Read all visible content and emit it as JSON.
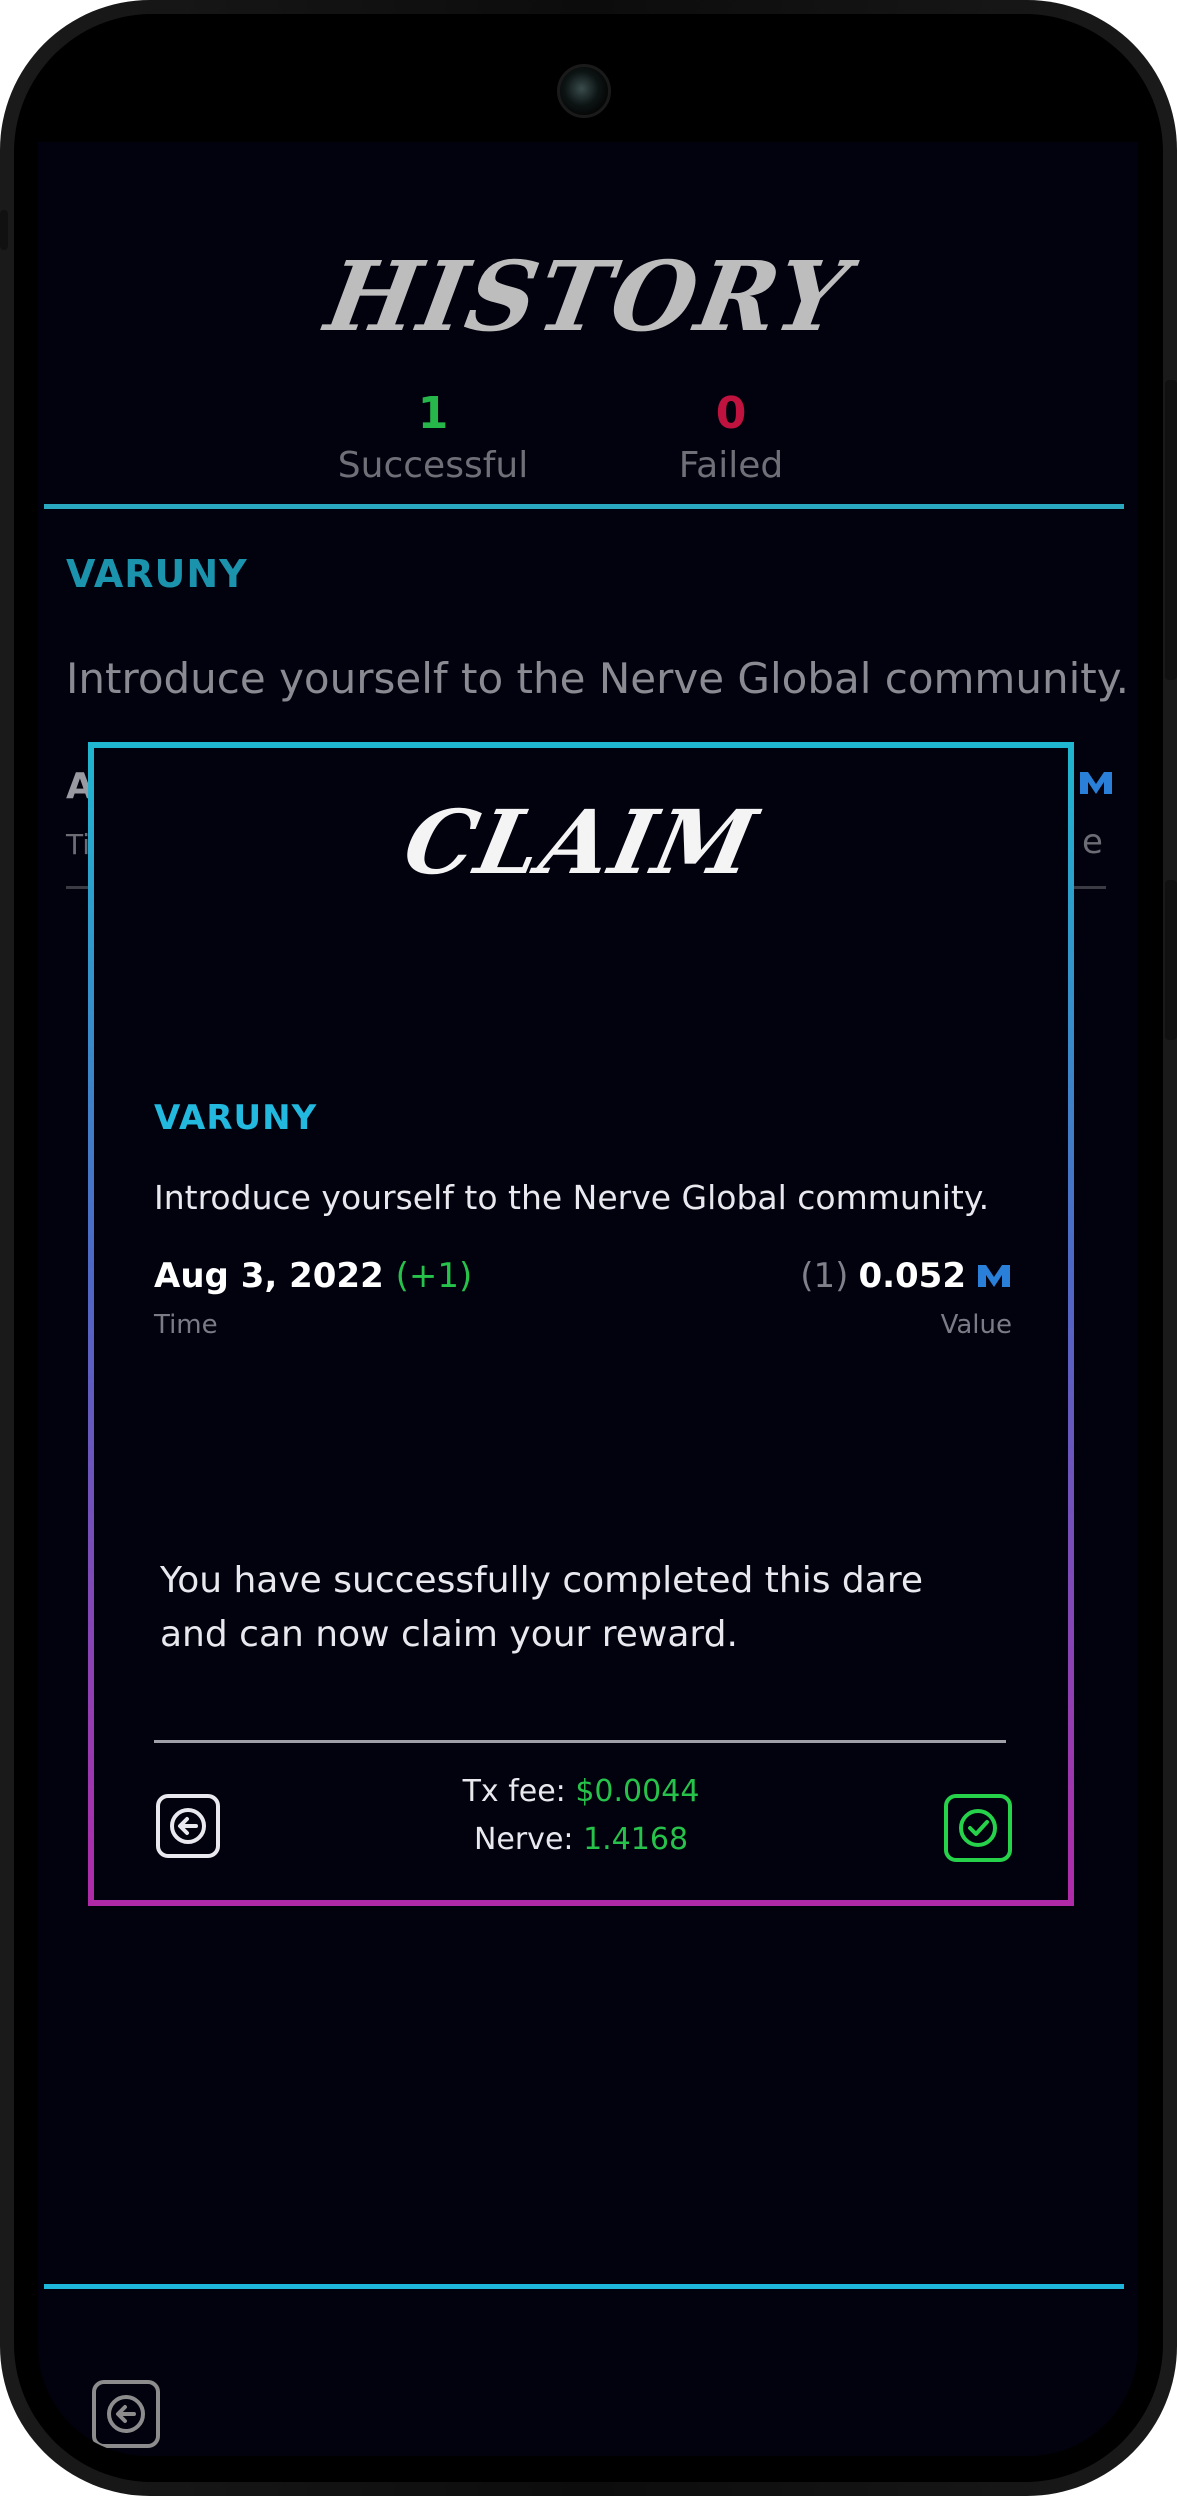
{
  "history": {
    "title": "HISTORY",
    "successful_count": "1",
    "successful_label": "Successful",
    "failed_count": "0",
    "failed_label": "Failed"
  },
  "background_dare": {
    "name": "VARUNY",
    "description": "Introduce yourself to the Nerve Global community.",
    "frag_left_top": "A",
    "frag_left_bottom": "Ti",
    "frag_right_bottom": "e"
  },
  "modal": {
    "title": "CLAIM",
    "dare_name": "VARUNY",
    "description": "Introduce yourself to the Nerve Global community.",
    "date": "Aug 3, 2022",
    "date_extra": "(+1)",
    "time_label": "Time",
    "count": "(1)",
    "value": "0.052",
    "value_label": "Value",
    "message": "You have successfully completed this dare and can now claim your reward.",
    "tx_fee_label": "Tx fee:",
    "tx_fee_value": "$0.0044",
    "nerve_label": "Nerve:",
    "nerve_value": "1.4168"
  },
  "colors": {
    "success": "#26c24a",
    "failed": "#c0123f",
    "accent_cyan": "#23b8de",
    "accent_magenta": "#b02aa8",
    "background": "#02020f"
  },
  "icons": [
    "back-arrow-icon",
    "check-icon",
    "nerve-token-icon"
  ]
}
